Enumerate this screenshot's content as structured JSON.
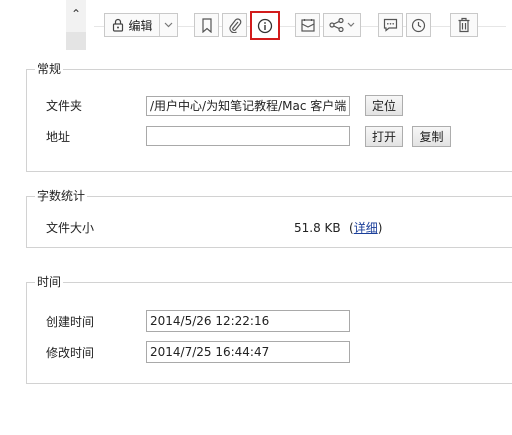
{
  "toolbar": {
    "scroll_up_icon": "chevron-up-icon",
    "edit_label": "编辑",
    "buttons": [
      "lock-icon",
      "bookmark-icon",
      "paperclip-icon",
      "info-icon",
      "note-icon",
      "share-icon",
      "comment-icon",
      "clock-icon",
      "trash-icon"
    ],
    "highlight_color": "#d21c1c"
  },
  "general": {
    "title": "常规",
    "folder_label": "文件夹",
    "folder_value": "/用户中心/为知笔记教程/Mac 客户端",
    "locate_button": "定位",
    "address_label": "地址",
    "address_value": "",
    "open_button": "打开",
    "copy_button": "复制"
  },
  "stats": {
    "title": "字数统计",
    "size_label": "文件大小",
    "size_value": "51.8 KB",
    "open_paren": "(",
    "details_link": "详细",
    "close_paren": ")"
  },
  "time": {
    "title": "时间",
    "created_label": "创建时间",
    "created_value": "2014/5/26 12:22:16",
    "modified_label": "修改时间",
    "modified_value": "2014/7/25 16:44:47"
  }
}
